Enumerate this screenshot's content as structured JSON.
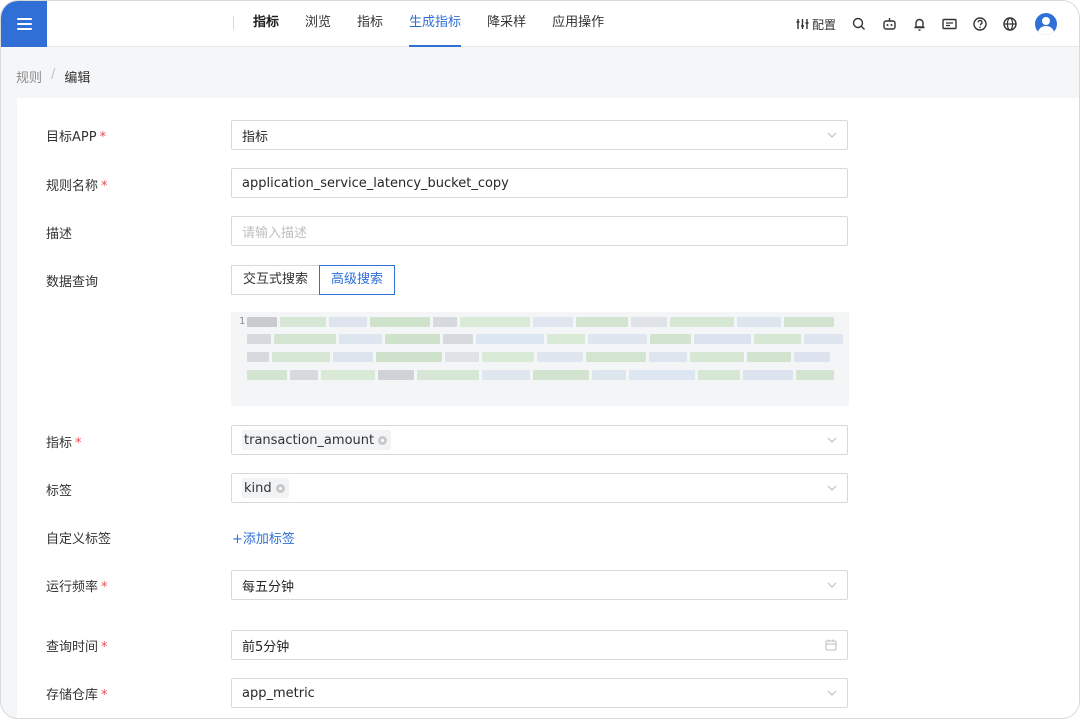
{
  "topnav": {
    "brand": "指标",
    "items": [
      "浏览",
      "指标",
      "生成指标",
      "降采样",
      "应用操作"
    ],
    "active": "生成指标",
    "config_label": "配置"
  },
  "breadcrumb": {
    "parent": "规则",
    "separator": "/",
    "current": "编辑"
  },
  "form": {
    "target_app": {
      "label": "目标APP",
      "required": true,
      "value": "指标"
    },
    "rule_name": {
      "label": "规则名称",
      "required": true,
      "value": "application_service_latency_bucket_copy"
    },
    "description": {
      "label": "描述",
      "placeholder": "请输入描述"
    },
    "data_query": {
      "label": "数据查询",
      "modes": [
        "交互式搜索",
        "高级搜索"
      ],
      "active_mode": "高级搜索",
      "line_number": "1"
    },
    "metric": {
      "label": "指标",
      "required": true,
      "tag": "transaction_amount"
    },
    "tags": {
      "label": "标签",
      "tag": "kind"
    },
    "custom_tags": {
      "label": "自定义标签",
      "add_link": "+添加标签"
    },
    "frequency": {
      "label": "运行频率",
      "required": true,
      "value": "每五分钟"
    },
    "query_time": {
      "label": "查询时间",
      "required": true,
      "value": "前5分钟"
    },
    "storage": {
      "label": "存储仓库",
      "required": true,
      "value": "app_metric"
    }
  },
  "colors": {
    "primary": "#2f6fd6",
    "required": "#e34d59"
  },
  "icons": [
    "menu-icon",
    "config-icon",
    "search-icon",
    "robot-icon",
    "bell-icon",
    "feedback-icon",
    "help-icon",
    "globe-icon",
    "user-avatar-icon",
    "chevron-down-icon",
    "calendar-icon",
    "tag-remove-icon"
  ]
}
